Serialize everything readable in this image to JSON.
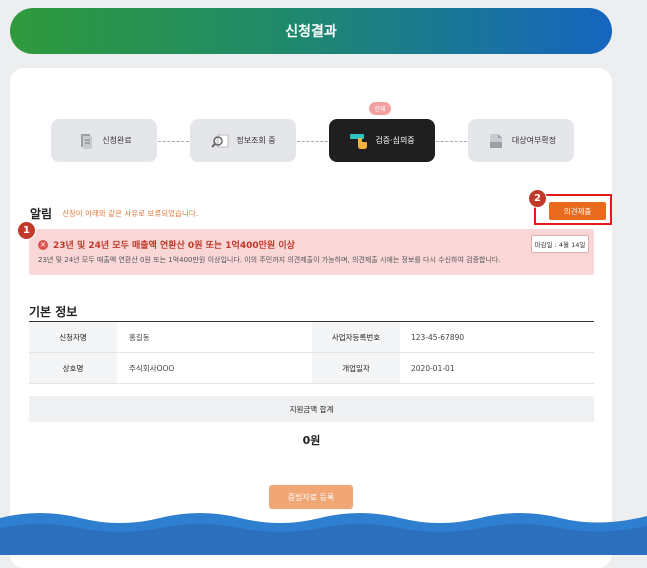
{
  "header": {
    "title": "신청결과"
  },
  "steps": {
    "badge": "현재",
    "items": [
      {
        "label": "신청완료",
        "icon": "document-stack-icon"
      },
      {
        "label": "정보조회 중",
        "icon": "magnifier-icon"
      },
      {
        "label": "검증·심의중",
        "icon": "hand-pointer-icon"
      },
      {
        "label": "대상여부확정",
        "icon": "file-icon"
      }
    ]
  },
  "alert": {
    "title": "알림",
    "subtitle": "신청이 아래와 같은 사유로 보류되었습니다.",
    "opinion_button": "의견제출",
    "marker_1": "1",
    "marker_2": "2",
    "reason_title": "23년 및 24년 모두 매출액 연환산 0원 또는 1억400만원 이상",
    "reason_body": "23년 및 24년 모두 매출액 연환산 0원 또는 1억400만원 이상입니다. 이의 주민까지 의견제출이 가능하며, 의견제출 시에는 정보를 다시 수신하여 검증합니다.",
    "deadline": "마감일 : 4월 14일"
  },
  "basic_info": {
    "title": "기본 정보",
    "rows": [
      {
        "label1": "신청자명",
        "value1": "홍길동",
        "label2": "사업자등록번호",
        "value2": "123-45-67890"
      },
      {
        "label1": "상호명",
        "value1": "주식회사OOO",
        "label2": "개업일자",
        "value2": "2020-01-01"
      }
    ]
  },
  "total": {
    "label": "지원금액 합계",
    "value": "0원"
  },
  "register_button": "증빙자료 등록",
  "colors": {
    "accent": "#e86a1c",
    "alert_bg": "#f9d7d7",
    "alert_text": "#c0392b",
    "active_step": "#1f1f1f"
  }
}
